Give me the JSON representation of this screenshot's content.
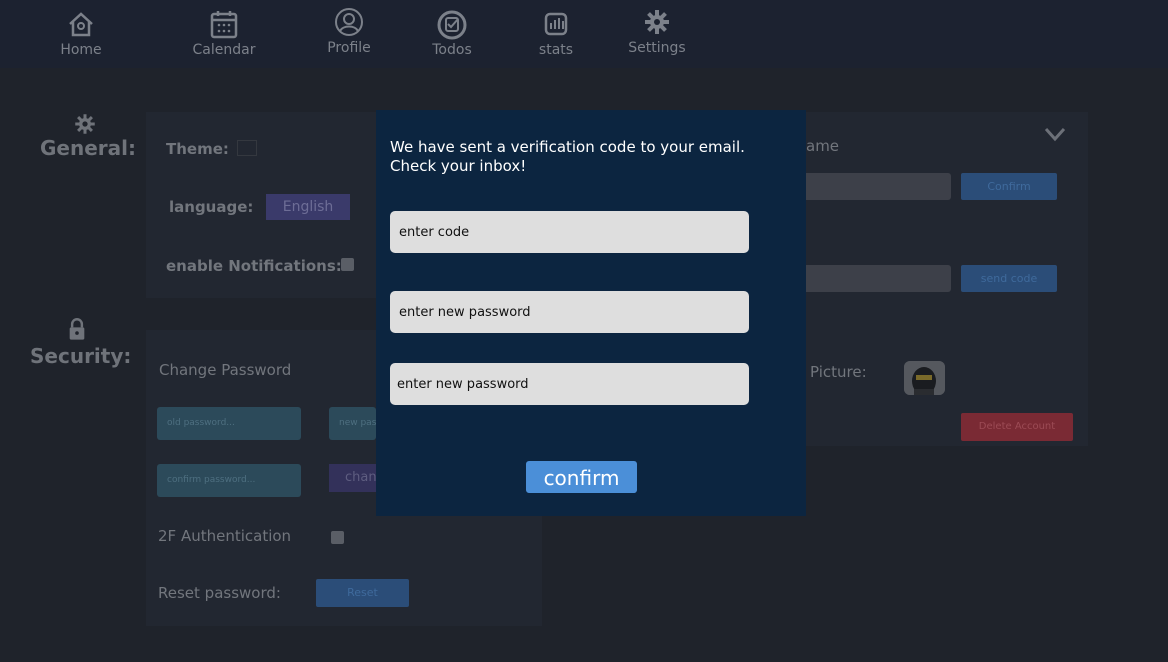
{
  "nav": {
    "items": [
      {
        "label": "Home",
        "icon": "home-icon"
      },
      {
        "label": "Calendar",
        "icon": "calendar-icon"
      },
      {
        "label": "Profile",
        "icon": "profile-icon"
      },
      {
        "label": "Todos",
        "icon": "todos-icon"
      },
      {
        "label": "stats",
        "icon": "stats-icon"
      },
      {
        "label": "Settings",
        "icon": "gear-icon"
      }
    ]
  },
  "general": {
    "heading": "General:",
    "theme_label": "Theme:",
    "language_label": "language:",
    "language_value": "English",
    "notifications_label": "enable Notifications:"
  },
  "security": {
    "heading": "Security:",
    "change_password_label": "Change Password",
    "old_password_placeholder": "old password...",
    "new_password_placeholder": "new password...",
    "confirm_password_placeholder": "confirm password...",
    "change_button": "change",
    "two_factor_label": "2F Authentication",
    "reset_label": "Reset password:",
    "reset_button": "Reset"
  },
  "account": {
    "username_label": "ame",
    "confirm_button": "Confirm",
    "send_code_button": "send code",
    "picture_label": "Picture:",
    "delete_button": "Delete Account"
  },
  "modal": {
    "message": "We have sent a verification code to your email. Check your inbox!",
    "code_placeholder": "enter code",
    "new_password_placeholder": "enter new password",
    "repeat_password_placeholder": "enter new password",
    "confirm_button": "confirm"
  },
  "colors": {
    "modal_bg": "#0c2540",
    "accent": "#4b8fd8",
    "danger": "#b3333f"
  }
}
